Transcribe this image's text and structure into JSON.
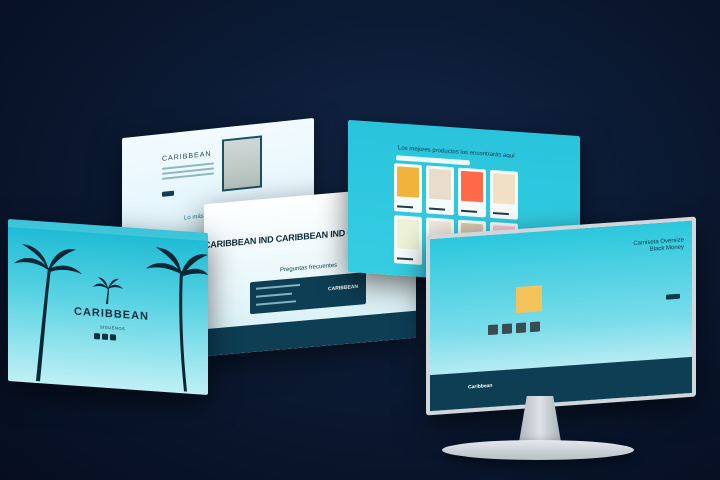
{
  "about_panel": {
    "brand": "CARIBBEAN",
    "best_sellers_title": "Lo más vendido"
  },
  "hero_panel": {
    "title": "CARIBBEAN",
    "subtitle": "SÍGUENOS"
  },
  "faq_panel": {
    "marquee": "CARIBBEAN IND CARIBBEAN IND CARIBBEAN IND CARI",
    "title": "Preguntas frecuentes",
    "logo": "CARIBBEAN"
  },
  "grid_panel": {
    "title": "Los mejores productos los encontrarás aquí",
    "shirts": [
      "#f2b33d",
      "#e8dccb",
      "#ff6a4b",
      "#f1e0c6",
      "#eef2d8",
      "#efe8dd",
      "#d9c7ae",
      "#f6c9d3"
    ]
  },
  "monitor": {
    "product_title_line1": "Camiseta Oversize",
    "product_title_line2": "Black Money",
    "footer_logo": "Caribbean"
  },
  "colors": {
    "accent": "#29c4dc",
    "dark": "#0e3e54",
    "background": "#0b1a33"
  }
}
